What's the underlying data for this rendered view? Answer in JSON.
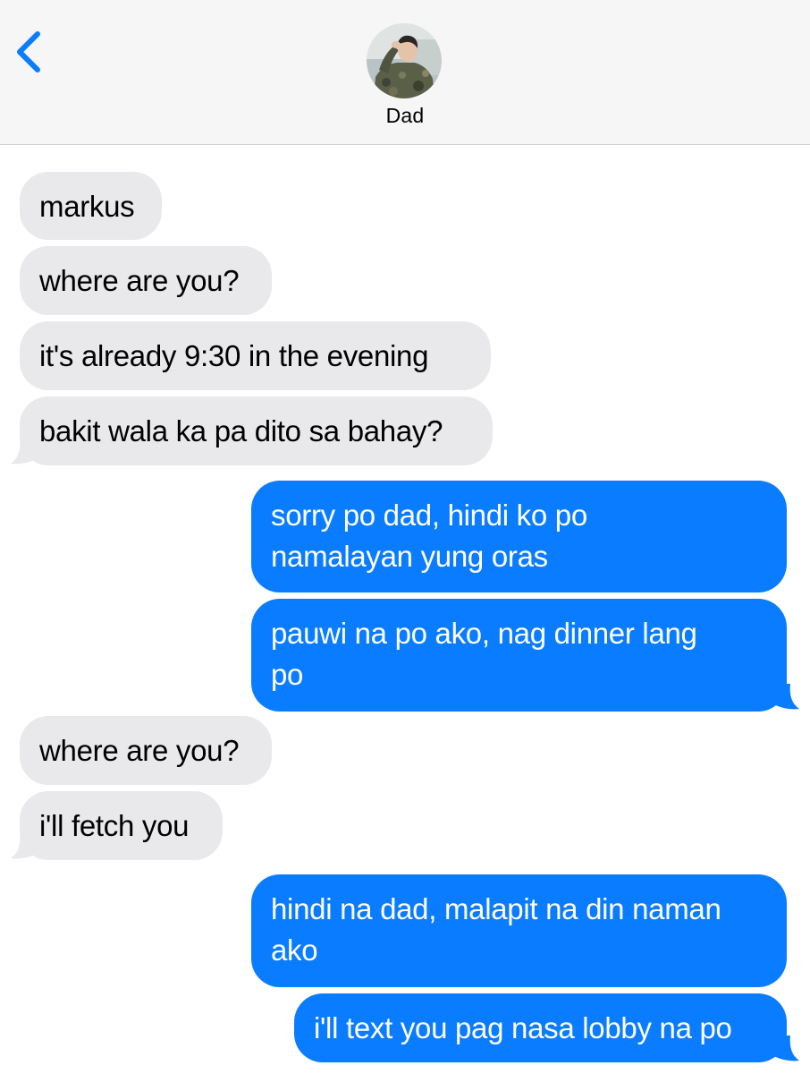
{
  "app": {
    "contact_name": "Dad",
    "colors": {
      "incoming_bubble": "#e9e9eb",
      "outgoing_bubble": "#0a7cff",
      "header_bg": "#f6f6f6",
      "accent": "#0a7cff"
    },
    "icons": {
      "back": "chevron-left-icon",
      "avatar": "contact-avatar"
    }
  },
  "messages": [
    {
      "direction": "incoming",
      "lines": [
        "markus"
      ]
    },
    {
      "direction": "incoming",
      "lines": [
        "where are you?"
      ]
    },
    {
      "direction": "incoming",
      "lines": [
        "it's already 9:30 in the evening"
      ]
    },
    {
      "direction": "incoming",
      "lines": [
        "bakit wala ka pa dito sa bahay?"
      ]
    },
    {
      "direction": "outgoing",
      "lines": [
        "sorry po dad, hindi ko po",
        "namalayan yung oras"
      ]
    },
    {
      "direction": "outgoing",
      "lines": [
        "pauwi na po ako, nag dinner lang",
        "po"
      ]
    },
    {
      "direction": "incoming",
      "lines": [
        "where are you?"
      ]
    },
    {
      "direction": "incoming",
      "lines": [
        "i'll fetch you"
      ]
    },
    {
      "direction": "outgoing",
      "lines": [
        "hindi na dad, malapit na din naman",
        "ako"
      ]
    },
    {
      "direction": "outgoing",
      "lines": [
        "i'll text you pag nasa lobby na po"
      ]
    }
  ]
}
